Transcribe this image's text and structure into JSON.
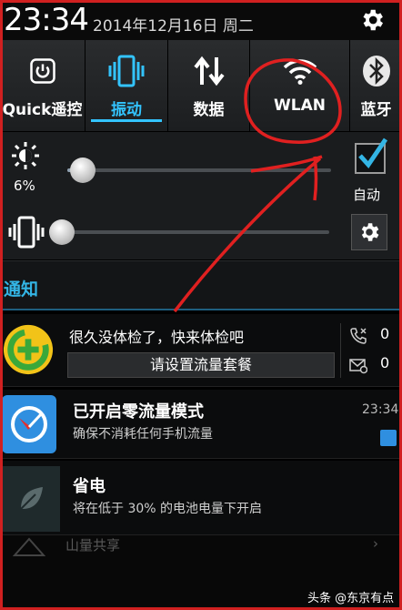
{
  "status": {
    "time": "23:34",
    "date": "2014年12月16日 周二"
  },
  "quick_toggles": [
    {
      "label": "Quick遥控",
      "icon": "power-button-icon",
      "active": false
    },
    {
      "label": "振动",
      "icon": "vibrate-phone-icon",
      "active": true
    },
    {
      "label": "数据",
      "icon": "data-arrows-icon",
      "active": false
    },
    {
      "label": "WLAN",
      "icon": "wifi-icon",
      "active": false
    },
    {
      "label": "蓝牙",
      "icon": "bluetooth-icon",
      "active": false
    }
  ],
  "brightness": {
    "percent_label": "6%",
    "level": 0.06,
    "auto_label": "自动",
    "auto_checked": true
  },
  "vibration": {
    "level": 0.0
  },
  "notifications_header": "通知",
  "notifications": {
    "security": {
      "text": "很久没体检了，快来体检吧",
      "button": "请设置流量套餐",
      "calls_count": "0",
      "messages_count": "0"
    },
    "zero_traffic": {
      "title": "已开启零流量模式",
      "subtitle": "确保不消耗任何手机流量",
      "time": "23:34"
    },
    "power_saving": {
      "title": "省电",
      "subtitle": "将在低于 30% 的电池电量下开启"
    }
  },
  "background_item": {
    "text": "山量共享",
    "arrow": "›"
  },
  "watermark": "头条 @东京有点冷",
  "colors": {
    "accent": "#33b5e5",
    "active_toggle": "#33c4ff",
    "annotation_red": "#e02020"
  }
}
